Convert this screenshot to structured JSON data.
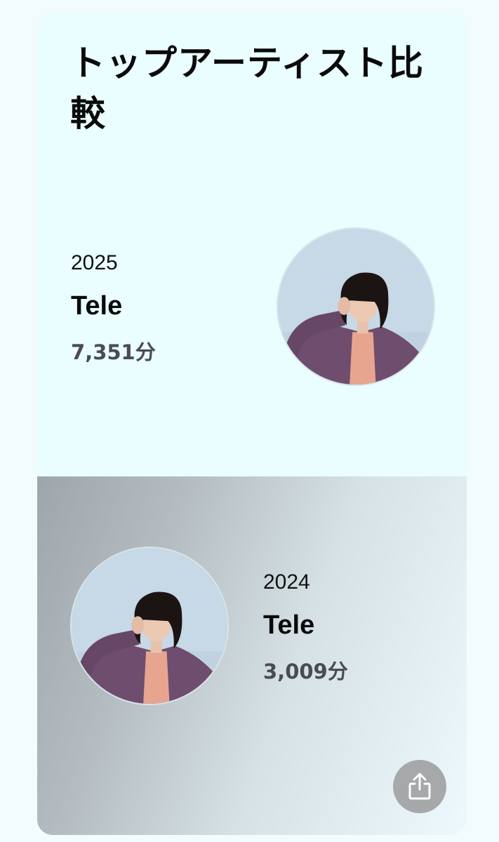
{
  "title": "トップアーティスト比較",
  "entries": [
    {
      "year": "2025",
      "artist": "Tele",
      "minutes": "7,351分",
      "avatar_icon": "artist-photo"
    },
    {
      "year": "2024",
      "artist": "Tele",
      "minutes": "3,009分",
      "avatar_icon": "artist-photo"
    }
  ],
  "share_icon": "share-icon",
  "colors": {
    "card_bg": "#eafeff",
    "text": "#0a0a0a",
    "secondary_text": "#4a4c4f",
    "share_button": "#a6a8aa"
  }
}
